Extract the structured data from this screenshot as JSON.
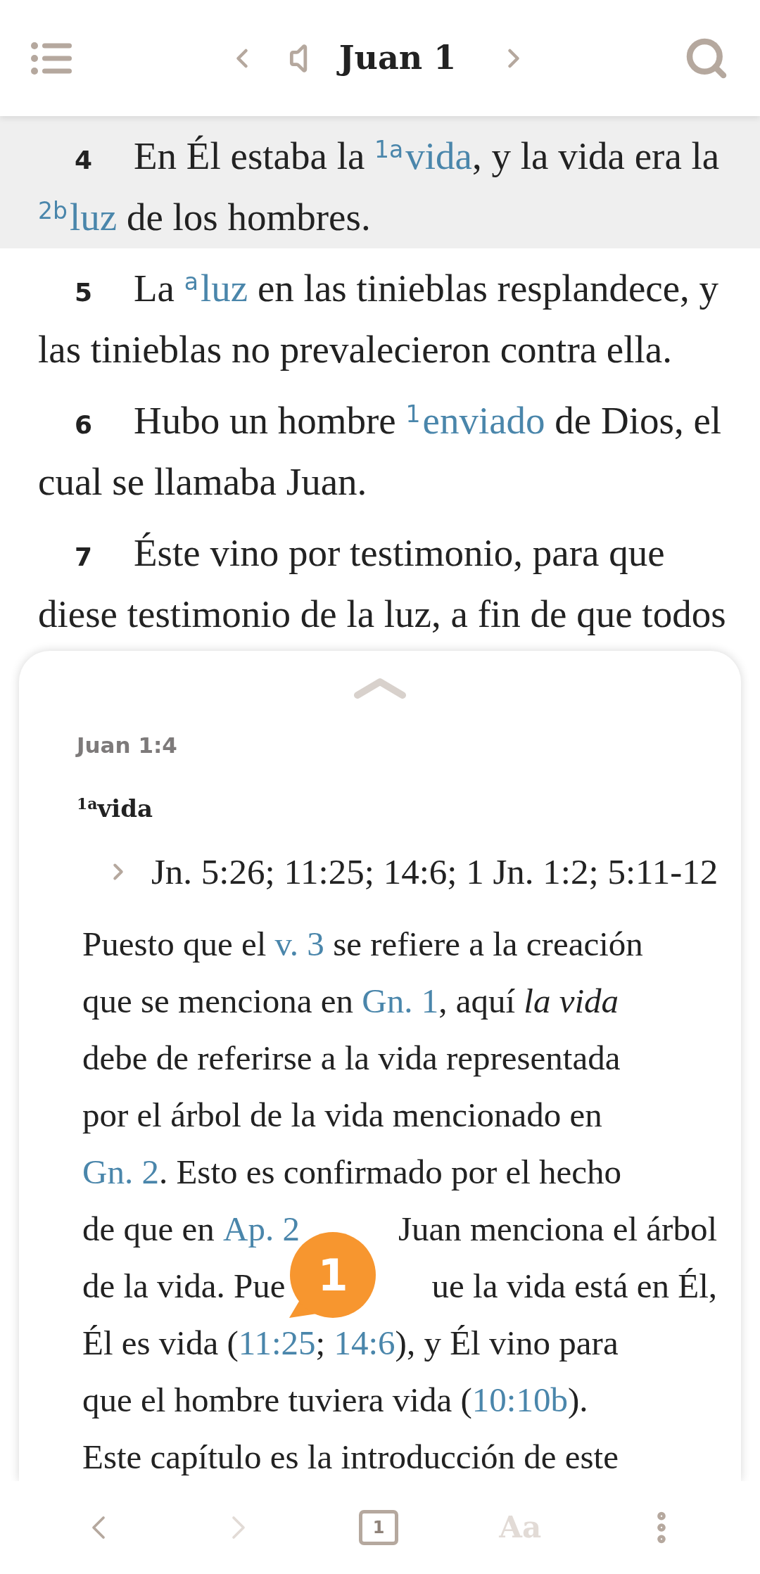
{
  "header": {
    "title": "Juan 1"
  },
  "verses": [
    {
      "number": "4",
      "selected": true,
      "segments": [
        {
          "kind": "text",
          "text": "En Él estaba la "
        },
        {
          "kind": "link",
          "mark": "1a",
          "text": "vida"
        },
        {
          "kind": "text",
          "text": ", y la vida era la "
        },
        {
          "kind": "link",
          "mark": "2b",
          "text": "luz"
        },
        {
          "kind": "text",
          "text": " de los hombres."
        }
      ]
    },
    {
      "number": "5",
      "selected": false,
      "segments": [
        {
          "kind": "text",
          "text": "La "
        },
        {
          "kind": "link",
          "mark": "a",
          "text": "luz"
        },
        {
          "kind": "text",
          "text": " en las tinieblas resplandece, y las tinieblas no prevalecieron contra ella."
        }
      ]
    },
    {
      "number": "6",
      "selected": false,
      "segments": [
        {
          "kind": "text",
          "text": "Hubo un hombre "
        },
        {
          "kind": "link",
          "mark": "1",
          "text": "enviado"
        },
        {
          "kind": "text",
          "text": " de Dios, el cual se llamaba Juan."
        }
      ]
    },
    {
      "number": "7",
      "selected": false,
      "segments": [
        {
          "kind": "text",
          "text": "Éste vino por testimonio, para que diese testimonio de la luz, a fin de que todos"
        }
      ]
    }
  ],
  "note_panel": {
    "reference": "Juan 1:4",
    "note_mark": "1a",
    "note_word": "vida",
    "cross_refs": "Jn. 5:26; 11:25; 14:6; 1 Jn. 1:2; 5:11-12",
    "lines": [
      [
        {
          "kind": "text",
          "text": "Puesto que el "
        },
        {
          "kind": "link",
          "text": "v. 3"
        },
        {
          "kind": "text",
          "text": " se refiere a la creación"
        }
      ],
      [
        {
          "kind": "text",
          "text": "que se menciona en "
        },
        {
          "kind": "link",
          "text": "Gn. 1"
        },
        {
          "kind": "text",
          "text": ", aquí "
        },
        {
          "kind": "italic",
          "text": "la vida"
        }
      ],
      [
        {
          "kind": "text",
          "text": "debe de referirse a la vida representada"
        }
      ],
      [
        {
          "kind": "text",
          "text": "por el árbol de la vida mencionado en"
        }
      ],
      [
        {
          "kind": "link",
          "text": "Gn. 2"
        },
        {
          "kind": "text",
          "text": ". Esto es confirmado por el hecho"
        }
      ],
      [
        {
          "kind": "text",
          "text": "de que en "
        },
        {
          "kind": "link",
          "text": "Ap. 2"
        },
        {
          "kind": "gap"
        },
        {
          "kind": "text",
          "text": "Juan menciona el árbol"
        }
      ],
      [
        {
          "kind": "text",
          "text": "de la vida. Pue"
        },
        {
          "kind": "gap"
        },
        {
          "kind": "text",
          "text": "ue la vida está en Él,"
        }
      ],
      [
        {
          "kind": "text",
          "text": "Él es vida ("
        },
        {
          "kind": "link",
          "text": "11:25"
        },
        {
          "kind": "text",
          "text": "; "
        },
        {
          "kind": "link",
          "text": "14:6"
        },
        {
          "kind": "text",
          "text": "), y Él vino para"
        }
      ],
      [
        {
          "kind": "text",
          "text": "que el hombre tuviera vida ("
        },
        {
          "kind": "link",
          "text": "10:10b"
        },
        {
          "kind": "text",
          "text": ")."
        }
      ],
      [
        {
          "kind": "text",
          "text": "Este capítulo es la introducción de este"
        }
      ]
    ]
  },
  "badge": {
    "count": "1"
  },
  "bottom_bar": [
    {
      "kind": "back",
      "disabled": false
    },
    {
      "kind": "forward",
      "disabled": true
    },
    {
      "kind": "chapter",
      "label": "1",
      "disabled": false
    },
    {
      "kind": "font",
      "label": "Aa",
      "disabled": true
    },
    {
      "kind": "more",
      "disabled": false
    }
  ]
}
